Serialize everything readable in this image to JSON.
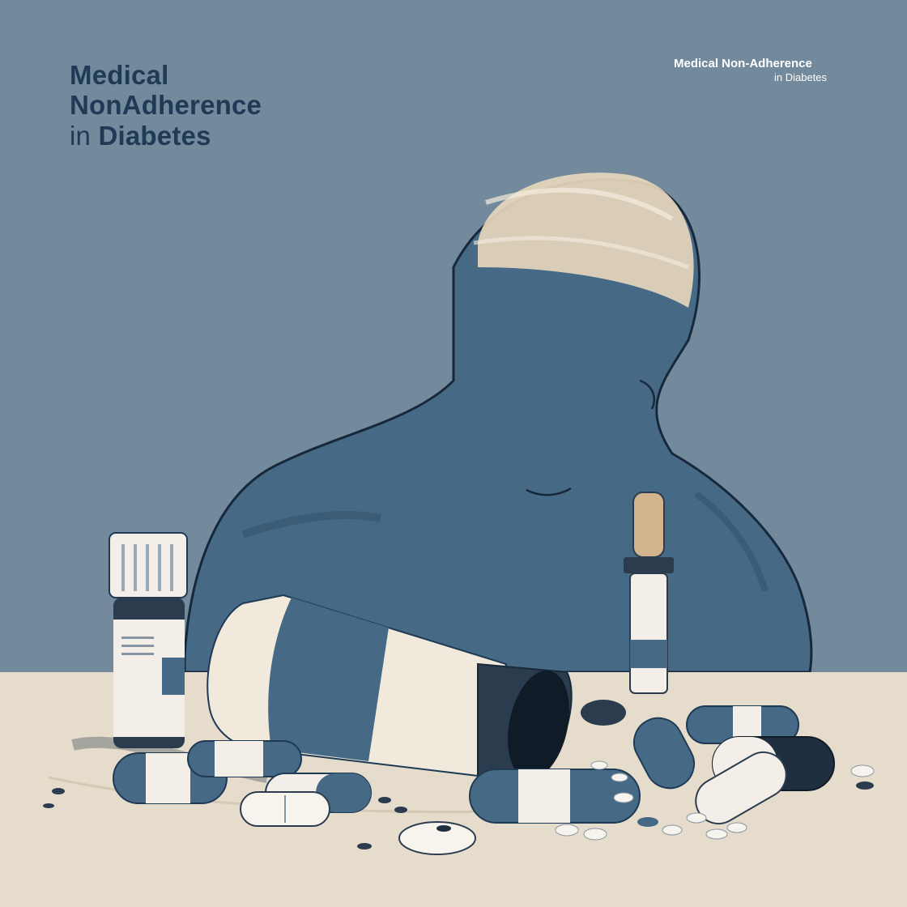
{
  "poster": {
    "title_line1": "Medical",
    "title_line2": "NonAdherence",
    "title_line3_prefix": "in",
    "title_line3_main": "Diabetes",
    "corner_line1": "Medical Non-Adherence",
    "corner_line2": "in Diabetes"
  },
  "colors": {
    "background": "#728a9b",
    "navy": "#1f3a54",
    "figure": "#466a86",
    "cream": "#ece4d6",
    "table": "#e6dccb"
  },
  "illustration": {
    "subject": "person with bowed head behind table with spilled pill bottle and capsules",
    "icons": [
      "person-silhouette-icon",
      "pill-bottle-icon",
      "dropper-vial-icon",
      "capsule-icon",
      "tablet-icon"
    ]
  }
}
